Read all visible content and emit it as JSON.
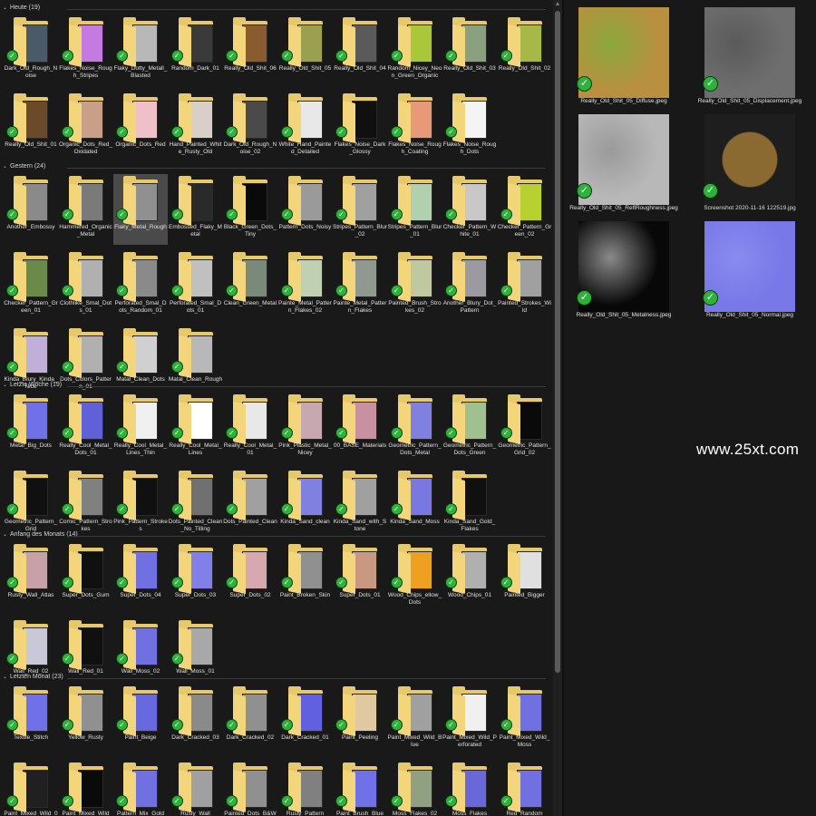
{
  "groups": [
    {
      "title": "Heute (19)",
      "items": [
        {
          "label": "Dark_Old_Rough_Noise",
          "thumb": "#4a5a68"
        },
        {
          "label": "Flakes_Noise_Rough_Stripes",
          "thumb": "#c47ae0"
        },
        {
          "label": "Flaky_Dotty_Metall_Blasted",
          "thumb": "#b8b8b8"
        },
        {
          "label": "Random_Dark_01",
          "thumb": "#3a3a3a"
        },
        {
          "label": "Really_Old_Shit_06",
          "thumb": "#8a5a30"
        },
        {
          "label": "Really_Old_Shit_05",
          "thumb": "#9aa050"
        },
        {
          "label": "Really_Old_Shit_04",
          "thumb": "#5a5a5a"
        },
        {
          "label": "Random_Nicey_Neon_Green_Organic",
          "thumb": "#a8c83a"
        },
        {
          "label": "Really_Old_Shit_03",
          "thumb": "#8aa080"
        },
        {
          "label": "Really_Old_Shit_02",
          "thumb": "#a8b848"
        },
        {
          "label": "Really_Old_Shit_01",
          "thumb": "#6a4a2a"
        },
        {
          "label": "Organic_Dots_Red_Oxidated",
          "thumb": "#c8a088"
        },
        {
          "label": "Organic_Dots_Red",
          "thumb": "#f0c0c8"
        },
        {
          "label": "Hand_Painted_White_Rusty_Old",
          "thumb": "#d8d0c8"
        },
        {
          "label": "Dark_Old_Rough_Noise_02",
          "thumb": "#4a4a4a"
        },
        {
          "label": "White_Hand_Painted_Detailed",
          "thumb": "#e8e8e8"
        },
        {
          "label": "Flakes_Noise_Dark_Glossy",
          "thumb": "#101010"
        },
        {
          "label": "Flakes_Noise_Rough_Coating",
          "thumb": "#e89a78"
        },
        {
          "label": "Flakes_Noise_Rough_Dots",
          "thumb": "#f4f4f4"
        }
      ]
    },
    {
      "title": "Gestern (24)",
      "items": [
        {
          "label": "Another_Embossy",
          "thumb": "#8a8a8a"
        },
        {
          "label": "Hammered_Organic_Metal",
          "thumb": "#7a7a7a"
        },
        {
          "label": "Flaky_Metal_Rough",
          "thumb": "#909090"
        },
        {
          "label": "Embossed_Flaky_Metal",
          "thumb": "#2a2a2a"
        },
        {
          "label": "Black_Green_Dots_Tiny",
          "thumb": "#0a0a0a"
        },
        {
          "label": "Pattern_Dots_Noisy",
          "thumb": "#9a9a9a"
        },
        {
          "label": "Stripes_Pattern_Blur_02",
          "thumb": "#a0a0a0"
        },
        {
          "label": "Stripes_Pattern_Blur_01",
          "thumb": "#b0d0b0"
        },
        {
          "label": "Checker_Pattern_White_01",
          "thumb": "#c8c8c8"
        },
        {
          "label": "Checker_Pattern_Green_02",
          "thumb": "#b8d030"
        },
        {
          "label": "Checker_Pattern_Green_01",
          "thumb": "#6a8a4a"
        },
        {
          "label": "Clothlike_Smal_Dots_01",
          "thumb": "#b0b0b0"
        },
        {
          "label": "Perforated_Smal_Dots_Random_01",
          "thumb": "#8a8a8a"
        },
        {
          "label": "Perforated_Smal_Dots_01",
          "thumb": "#c0c0c0"
        },
        {
          "label": "Clean_Green_Metal",
          "thumb": "#7a8a7a"
        },
        {
          "label": "Painte_Metal_Pattern_Flakes_02",
          "thumb": "#c0d0b0"
        },
        {
          "label": "Painte_Metal_Pattern_Flakes",
          "thumb": "#909890"
        },
        {
          "label": "Painted_Brush_Strokes_02",
          "thumb": "#c0c8a0"
        },
        {
          "label": "Another_Blury_Dot_Pattern",
          "thumb": "#9a9aa0"
        },
        {
          "label": "Painted_Strokes_Wild",
          "thumb": "#a0a0a0"
        },
        {
          "label": "Kinda_Blury_Kinda_Nice",
          "thumb": "#c0b0d8"
        },
        {
          "label": "Dots_Colors_Pattern_01",
          "thumb": "#b0b0b0"
        },
        {
          "label": "Matal_Clean_Dots",
          "thumb": "#d0d0d0"
        },
        {
          "label": "Matal_Clean_Rough",
          "thumb": "#b8b8b8"
        }
      ]
    },
    {
      "title": "Letzte Woche (19)",
      "items": [
        {
          "label": "Metal_Big_Dots",
          "thumb": "#7070e8"
        },
        {
          "label": "Really_Cool_Metal_Dots_01",
          "thumb": "#6060d8"
        },
        {
          "label": "Really_Cool_Metal_Lines_Thin",
          "thumb": "#f0f0f0"
        },
        {
          "label": "Really_Cool_Metal_Lines",
          "thumb": "#ffffff"
        },
        {
          "label": "Really_Cool_Metal_01",
          "thumb": "#e8e8e8"
        },
        {
          "label": "Pink_Plastic_Metal_Nicey",
          "thumb": "#c8a8b0"
        },
        {
          "label": "00_BASE_Materials",
          "thumb": "#c890a0"
        },
        {
          "label": "Geometric_Pattern_Dots_Metal",
          "thumb": "#8080e0"
        },
        {
          "label": "Geometric_Pattern_Dots_Green",
          "thumb": "#a0c090"
        },
        {
          "label": "Geometric_Pattern_Grid_02",
          "thumb": "#0a0a0a"
        },
        {
          "label": "Geometric_Pattern_Grid",
          "thumb": "#101010"
        },
        {
          "label": "Comic_Pattern_Strokes",
          "thumb": "#808080"
        },
        {
          "label": "Pink_Pattern_Strokes",
          "thumb": "#101010"
        },
        {
          "label": "Dots_Painted_Clean_No_Tilling",
          "thumb": "#707070"
        },
        {
          "label": "Dots_Painted_Clean",
          "thumb": "#a0a0a0"
        },
        {
          "label": "Kinda_Sand_clean",
          "thumb": "#8080e0"
        },
        {
          "label": "Kinda_Sand_with_Stone",
          "thumb": "#a0a0a0"
        },
        {
          "label": "Kinda_Sand_Moss",
          "thumb": "#7878e0"
        },
        {
          "label": "Kinda_Sand_Gold_Flakes",
          "thumb": "#101010"
        }
      ]
    },
    {
      "title": "Anfang des Monats (14)",
      "items": [
        {
          "label": "Rusty_Wall_Atlas",
          "thumb": "#c8a0a8"
        },
        {
          "label": "Super_Dots_Gum",
          "thumb": "#101010"
        },
        {
          "label": "Super_Dots_04",
          "thumb": "#7070e0"
        },
        {
          "label": "Super_Dots_03",
          "thumb": "#8080e8"
        },
        {
          "label": "Super_Dots_02",
          "thumb": "#d8a8b0"
        },
        {
          "label": "Paint_Broken_Skin",
          "thumb": "#909090"
        },
        {
          "label": "Super_Dots_01",
          "thumb": "#c89880"
        },
        {
          "label": "Wood_Chips_ellow_Dots",
          "thumb": "#f0a020"
        },
        {
          "label": "Wood_Chips_01",
          "thumb": "#b0b0b0"
        },
        {
          "label": "Painted_Bigger",
          "thumb": "#e0e0e0"
        },
        {
          "label": "Wall_Red_02",
          "thumb": "#c8c8d8"
        },
        {
          "label": "Wall_Red_01",
          "thumb": "#101010"
        },
        {
          "label": "Wall_Moss_02",
          "thumb": "#7070e0"
        },
        {
          "label": "Wall_Moss_01",
          "thumb": "#a8a8a8"
        }
      ]
    },
    {
      "title": "Letzten Monat (23)",
      "items": [
        {
          "label": "Textile_Stitch",
          "thumb": "#7070e8"
        },
        {
          "label": "Yellow_Rusty",
          "thumb": "#909090"
        },
        {
          "label": "Paint_Beige",
          "thumb": "#6868e0"
        },
        {
          "label": "Dark_Cracked_03",
          "thumb": "#8a8a8a"
        },
        {
          "label": "Dark_Cracked_02",
          "thumb": "#909090"
        },
        {
          "label": "Dark_Cracked_01",
          "thumb": "#6060e0"
        },
        {
          "label": "Paint_Peeling",
          "thumb": "#e0c8a0"
        },
        {
          "label": "Paint_Mixed_Wild_Blue",
          "thumb": "#a0a0a0"
        },
        {
          "label": "Paint_Mixed_Wild_Perforated",
          "thumb": "#f0f0f0"
        },
        {
          "label": "Paint_Mixed_Wild_Moss",
          "thumb": "#7070e0"
        },
        {
          "label": "Paint_Mixed_Wild_02",
          "thumb": "#202020"
        },
        {
          "label": "Paint_Mixed_Wild",
          "thumb": "#0a0a0a"
        },
        {
          "label": "Pattern_Mix_Gold",
          "thumb": "#7070e0"
        },
        {
          "label": "Rusty_Wall",
          "thumb": "#a0a0a0"
        },
        {
          "label": "Painted_Dots_B&W",
          "thumb": "#909090"
        },
        {
          "label": "Rusty_Pattern",
          "thumb": "#808080"
        },
        {
          "label": "Paint_Brush_Blue",
          "thumb": "#7070e8"
        },
        {
          "label": "Moss_Flakes_02",
          "thumb": "#90a080"
        },
        {
          "label": "Moss_Flakes",
          "thumb": "#6868d8"
        },
        {
          "label": "Red_Random",
          "thumb": "#7070e0"
        }
      ]
    }
  ],
  "preview": [
    {
      "label": "Really_Old_Shit_05_Diffuse.jpeg",
      "thumb": "#b89040",
      "accent": "#8aa83a"
    },
    {
      "label": "Really_Old_Shit_05_Displacement.jpeg",
      "thumb": "#6e6e6e",
      "accent": "#5a5a5a"
    },
    {
      "label": "Really_Old_Shit_05_ReflRoughness.jpeg",
      "thumb": "#b8b8b8",
      "accent": "#9a9a9a"
    },
    {
      "label": "Screenshot 2020-11-16 122519.jpg",
      "thumb": "#1e1e1e",
      "accent": "#8a6a30"
    },
    {
      "label": "Really_Old_Shit_05_Metalness.jpeg",
      "thumb": "#080808",
      "accent": "#8a8a8a"
    },
    {
      "label": "Really_Old_Shit_05_Normal.jpeg",
      "thumb": "#7878e8",
      "accent": "#8a8af0"
    }
  ],
  "watermark": "www.25xt.com",
  "icons": {
    "check": "check-icon",
    "folder": "folder-icon",
    "chevron": "chevron-down-icon"
  },
  "colors": {
    "folder": "#e7c86b",
    "check": "#2eb33a",
    "background": "#191919"
  }
}
